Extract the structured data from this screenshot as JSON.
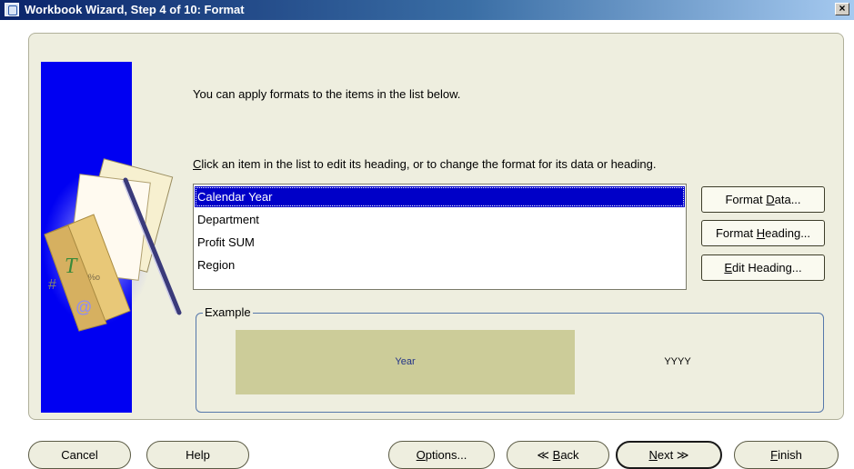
{
  "window": {
    "title": "Workbook Wizard, Step 4 of 10: Format",
    "close_glyph": "×"
  },
  "content": {
    "intro": "You can apply formats to the items in the list below.",
    "instruction": {
      "mnemonic": "C",
      "rest": "lick an item in the list to edit its heading, or to change the format for its data or heading."
    }
  },
  "items_list": {
    "items": [
      "Calendar Year",
      "Department",
      "Profit SUM",
      "Region"
    ],
    "selected_index": 0
  },
  "side_buttons": {
    "format_data": {
      "before": "Format ",
      "mnemonic": "D",
      "after": "ata..."
    },
    "format_heading": {
      "before": "Format ",
      "mnemonic": "H",
      "after": "eading..."
    },
    "edit_heading": {
      "before": "",
      "mnemonic": "E",
      "after": "dit Heading..."
    }
  },
  "example": {
    "legend": "Example",
    "heading_text": "Year",
    "data_text": "YYYY"
  },
  "nav": {
    "cancel": {
      "before": "Cancel",
      "mnemonic": "",
      "after": ""
    },
    "help": {
      "before": "Help",
      "mnemonic": "",
      "after": ""
    },
    "options": {
      "before": "",
      "mnemonic": "O",
      "after": "ptions..."
    },
    "back": {
      "before": "≪ ",
      "mnemonic": "B",
      "after": "ack"
    },
    "next": {
      "before": "",
      "mnemonic": "N",
      "after": "ext ≫"
    },
    "finish": {
      "before": "",
      "mnemonic": "F",
      "after": "inish"
    }
  },
  "colors": {
    "panel_background": "#eeeedf",
    "selection": "#0000c8",
    "image_blue": "#0000f2",
    "example_heading_background": "#cccc99",
    "example_heading_text": "#223388"
  }
}
